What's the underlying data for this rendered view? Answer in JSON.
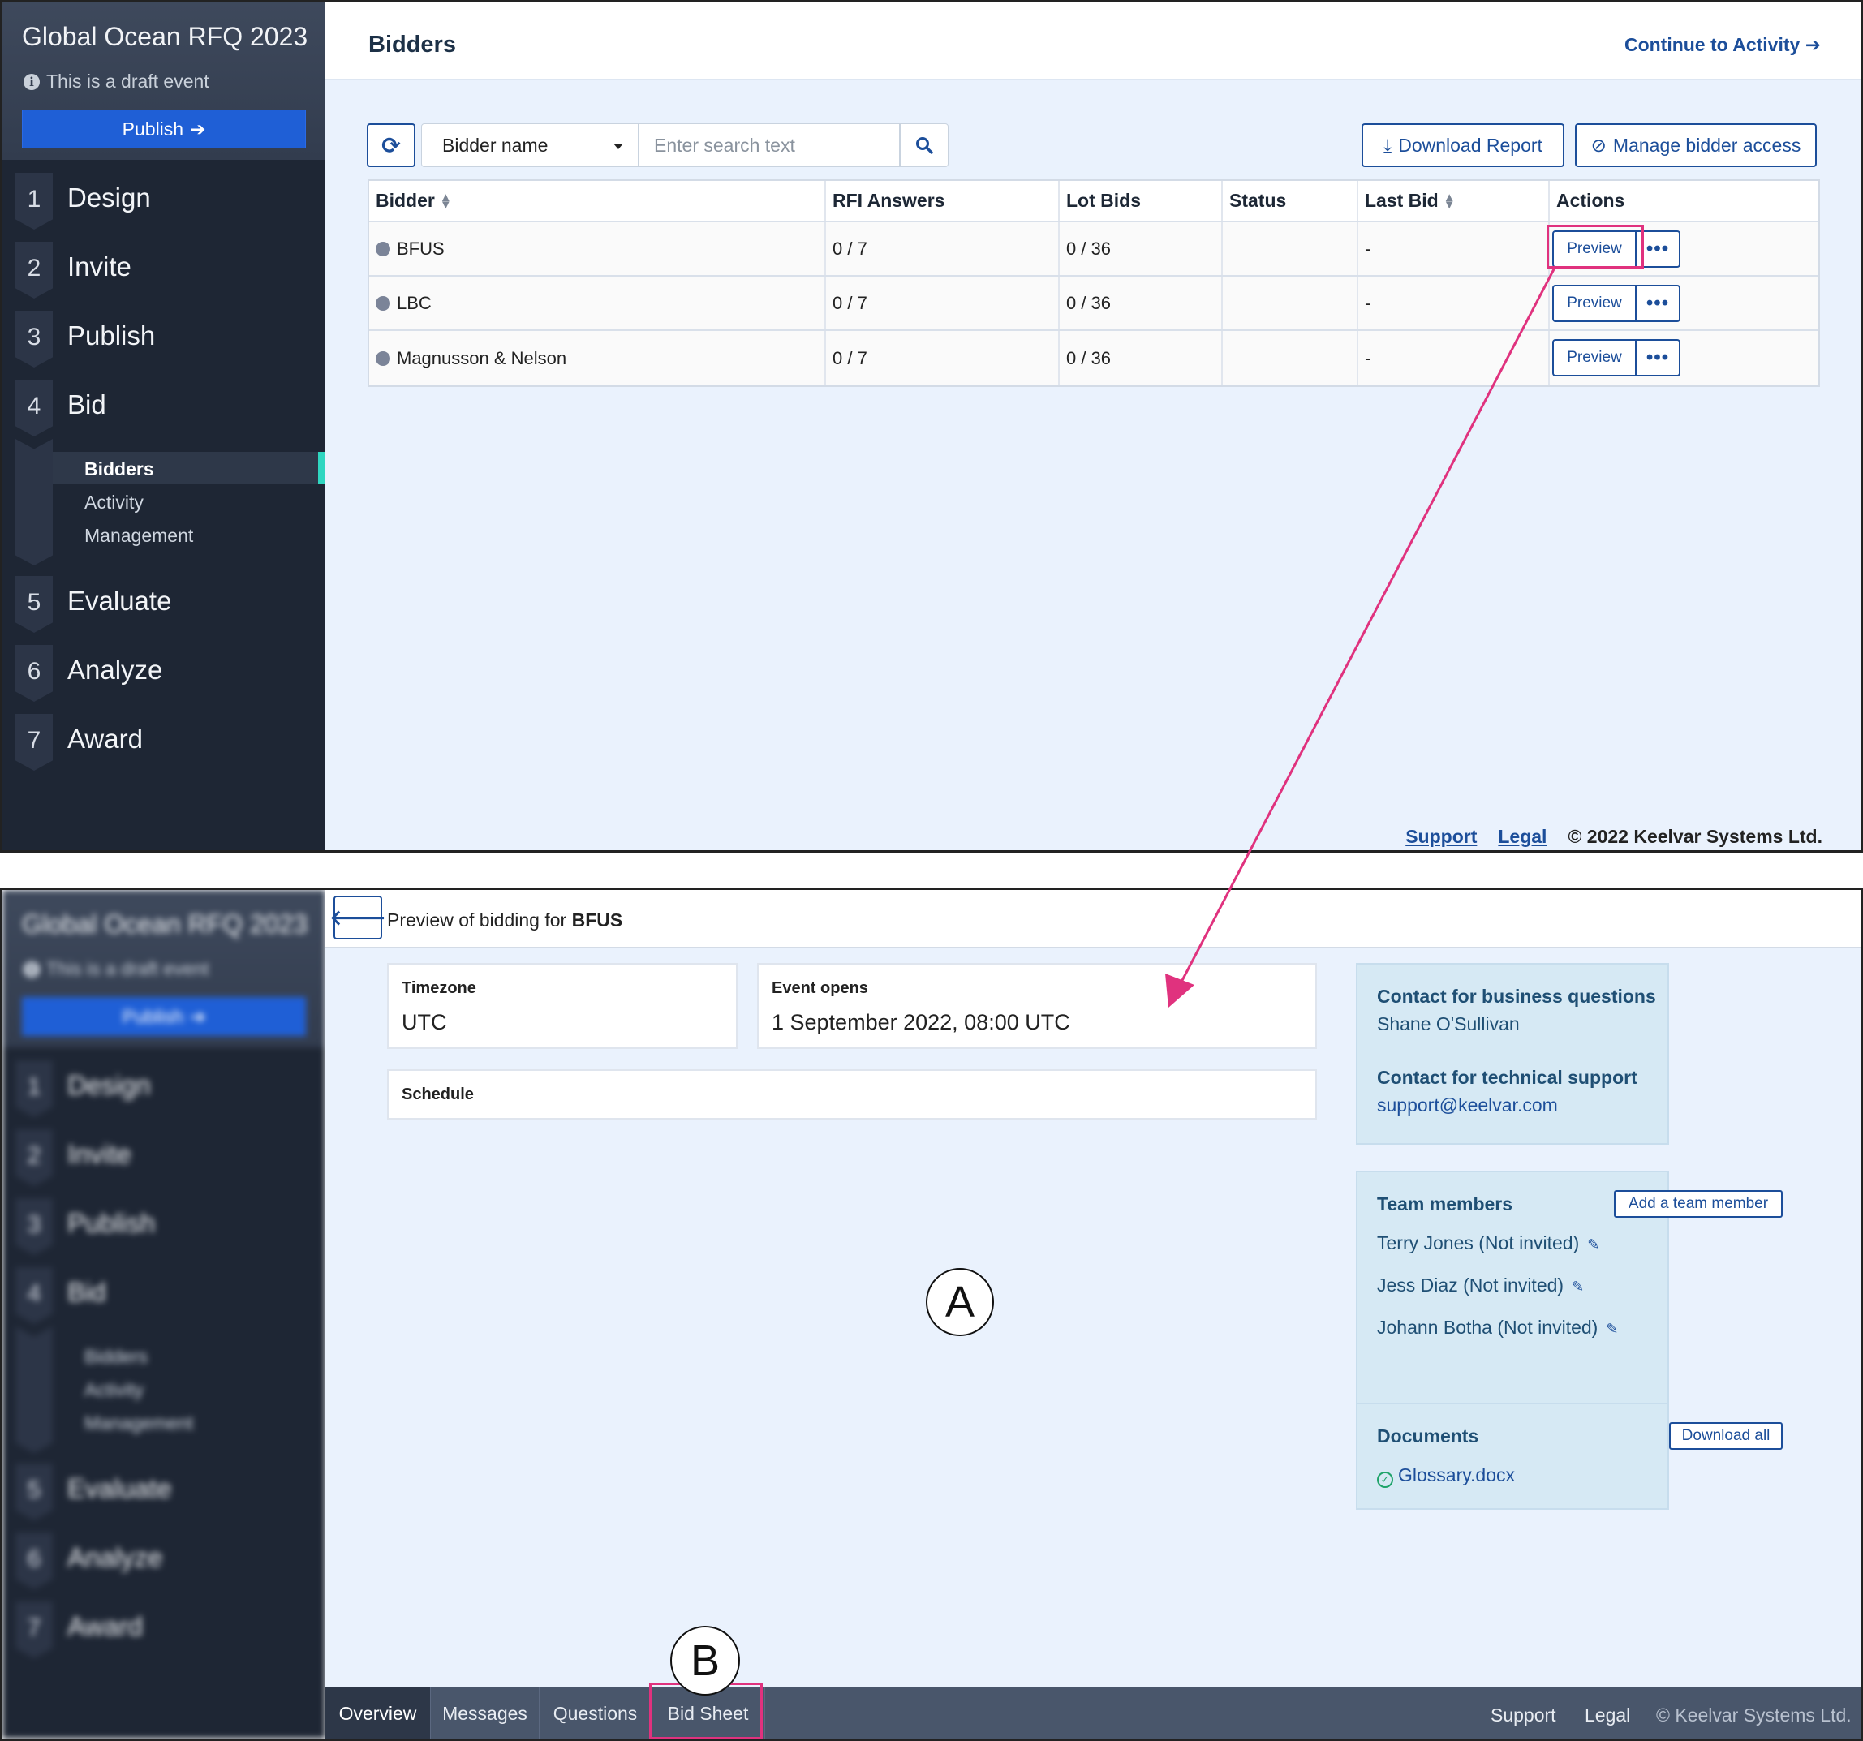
{
  "sidebar": {
    "event_title": "Global Ocean RFQ 2023",
    "draft_notice": "This is a draft event",
    "publish_label": "Publish",
    "steps": [
      {
        "num": "1",
        "label": "Design"
      },
      {
        "num": "2",
        "label": "Invite"
      },
      {
        "num": "3",
        "label": "Publish"
      },
      {
        "num": "4",
        "label": "Bid"
      },
      {
        "num": "5",
        "label": "Evaluate"
      },
      {
        "num": "6",
        "label": "Analyze"
      },
      {
        "num": "7",
        "label": "Award"
      }
    ],
    "bid_subitems": [
      "Bidders",
      "Activity",
      "Management"
    ],
    "active_subitem": "Bidders"
  },
  "bidders_page": {
    "title": "Bidders",
    "continue_label": "Continue to Activity",
    "filter_select": "Bidder name",
    "search_placeholder": "Enter search text",
    "download_label": "Download Report",
    "manage_access_label": "Manage bidder access",
    "columns": [
      "Bidder",
      "RFI Answers",
      "Lot Bids",
      "Status",
      "Last Bid",
      "Actions"
    ],
    "rows": [
      {
        "bidder": "BFUS",
        "rfi": "0 / 7",
        "lots": "0 / 36",
        "status": "",
        "last_bid": "-"
      },
      {
        "bidder": "LBC",
        "rfi": "0 / 7",
        "lots": "0 / 36",
        "status": "",
        "last_bid": "-"
      },
      {
        "bidder": "Magnusson & Nelson",
        "rfi": "0 / 7",
        "lots": "0 / 36",
        "status": "",
        "last_bid": "-"
      }
    ],
    "preview_label": "Preview",
    "footer": {
      "support": "Support",
      "legal": "Legal",
      "copyright": "© 2022 Keelvar Systems Ltd."
    }
  },
  "preview_page": {
    "title_prefix": "Preview of bidding for",
    "bidder": "BFUS",
    "timezone_label": "Timezone",
    "timezone_value": "UTC",
    "event_opens_label": "Event opens",
    "event_opens_value": "1 September 2022, 08:00 UTC",
    "schedule_label": "Schedule",
    "business_contact_heading": "Contact for business questions",
    "business_contact": "Shane O'Sullivan",
    "tech_contact_heading": "Contact for technical support",
    "tech_contact": "support@keelvar.com",
    "team_heading": "Team members",
    "add_member_label": "Add a team member",
    "team_members": [
      "Terry Jones (Not invited)",
      "Jess Diaz (Not invited)",
      "Johann Botha (Not invited)"
    ],
    "documents_heading": "Documents",
    "download_all_label": "Download all",
    "documents": [
      "Glossary.docx"
    ],
    "tabs": [
      "Overview",
      "Messages",
      "Questions",
      "Bid Sheet"
    ],
    "active_tab": "Overview",
    "footer": {
      "support": "Support",
      "legal": "Legal",
      "copyright": "© Keelvar Systems Ltd."
    }
  },
  "annotations": {
    "mark_a": "A",
    "mark_b": "B"
  },
  "colors": {
    "highlight": "#e0327e",
    "accent": "#1c4e9a",
    "sidebar": "#1e2634",
    "publish": "#1f5fd6"
  }
}
